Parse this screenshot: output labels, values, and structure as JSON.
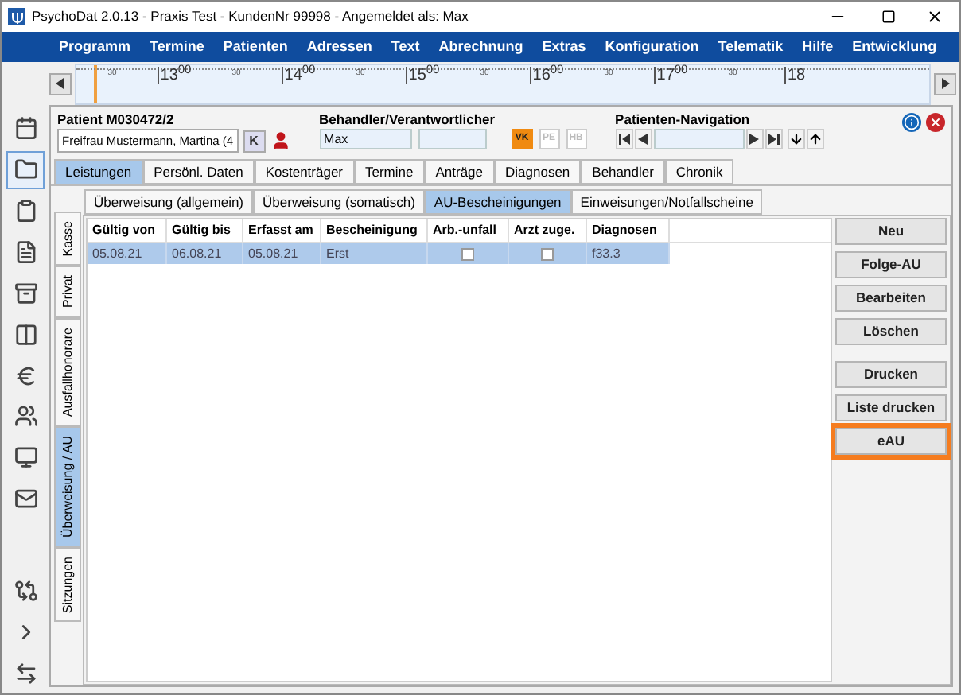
{
  "window": {
    "title": "PsychoDat 2.0.13 - Praxis Test - KundenNr 99998 - Angemeldet als: Max"
  },
  "menu": [
    "Programm",
    "Termine",
    "Patienten",
    "Adressen",
    "Text",
    "Abrechnung",
    "Extras",
    "Konfiguration",
    "Telematik",
    "Hilfe",
    "Entwicklung"
  ],
  "timeline": {
    "labels": [
      {
        "kind": "half",
        "text": "30"
      },
      {
        "kind": "hour",
        "text": "13$^{00}$"
      },
      {
        "kind": "half",
        "text": "30"
      },
      {
        "kind": "hour",
        "text": "14$^{00}$"
      },
      {
        "kind": "half",
        "text": "30"
      },
      {
        "kind": "hour",
        "text": "15$^{00}$"
      },
      {
        "kind": "half",
        "text": "30"
      },
      {
        "kind": "hour",
        "text": "16$^{00}$"
      },
      {
        "kind": "half",
        "text": "30"
      },
      {
        "kind": "hour",
        "text": "17$^{00}$"
      },
      {
        "kind": "half",
        "text": "30"
      },
      {
        "kind": "hour",
        "text": "18"
      }
    ],
    "level": 0.02
  },
  "sidebar": {
    "items": [
      {
        "selected": false
      },
      {
        "selected": true
      },
      {
        "selected": false
      },
      {
        "selected": false
      },
      {
        "selected": false
      },
      {
        "selected": false
      },
      {
        "selected": false
      },
      {
        "selected": false
      },
      {
        "selected": false
      },
      {
        "selected": false
      },
      {
        "selected": false
      },
      {
        "selected": false
      },
      {
        "selected": false
      }
    ]
  },
  "patient": {
    "label": "Patient M030472/2",
    "name": "Freifrau Mustermann, Martina (4",
    "k_button": "K"
  },
  "behandler": {
    "label": "Behandler/Verantwortlicher",
    "value": "Max",
    "badges": [
      {
        "text": "VK",
        "on": true
      },
      {
        "text": "PE",
        "on": false
      },
      {
        "text": "HB",
        "on": false
      }
    ]
  },
  "navigation": {
    "label": "Patienten-Navigation"
  },
  "tabs": [
    {
      "label": "Leistungen",
      "selected": true
    },
    {
      "label": "Persönl. Daten",
      "selected": false
    },
    {
      "label": "Kostenträger",
      "selected": false
    },
    {
      "label": "Termine",
      "selected": false
    },
    {
      "label": "Anträge",
      "selected": false
    },
    {
      "label": "Diagnosen",
      "selected": false
    },
    {
      "label": "Behandler",
      "selected": false
    },
    {
      "label": "Chronik",
      "selected": false
    }
  ],
  "side_tabs": [
    {
      "label": "Kasse",
      "selected": false
    },
    {
      "label": "Privat",
      "selected": false
    },
    {
      "label": "Ausfallhonorare",
      "selected": false
    },
    {
      "label": "Überweisung / AU",
      "selected": true
    },
    {
      "label": "Sitzungen",
      "selected": false
    }
  ],
  "sub_tabs": [
    {
      "label": "Überweisung (allgemein)",
      "selected": false
    },
    {
      "label": "Überweisung (somatisch)",
      "selected": false
    },
    {
      "label": "AU-Bescheinigungen",
      "selected": true
    },
    {
      "label": "Einweisungen/Notfallscheine",
      "selected": false
    }
  ],
  "table": {
    "columns": [
      "Gültig von",
      "Gültig bis",
      "Erfasst am",
      "Bescheinigung",
      "Arb.-unfall",
      "Arzt zuge.",
      "Diagnosen"
    ],
    "rows": [
      {
        "selected": true,
        "cells": [
          "05.08.21",
          "06.08.21",
          "05.08.21",
          "Erst",
          {
            "checked": false
          },
          {
            "checked": false
          },
          "f33.3"
        ]
      }
    ]
  },
  "buttons": [
    {
      "label": "Neu",
      "highlighted": false
    },
    {
      "label": "Folge-AU",
      "highlighted": false
    },
    {
      "label": "Bearbeiten",
      "highlighted": false
    },
    {
      "label": "Löschen",
      "highlighted": false
    },
    {
      "label": "Drucken",
      "highlighted": false,
      "gap": true
    },
    {
      "label": "Liste drucken",
      "highlighted": false
    },
    {
      "label": "eAU",
      "highlighted": true
    }
  ]
}
